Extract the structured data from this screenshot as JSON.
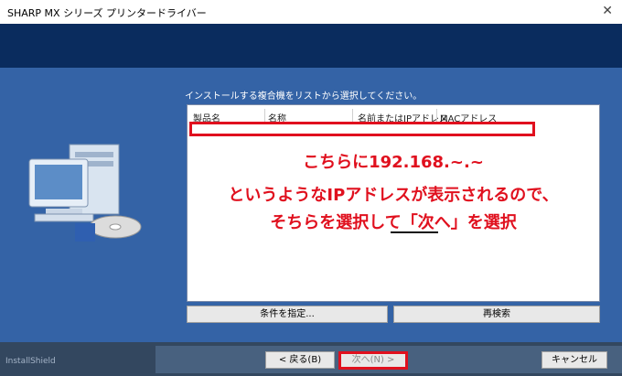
{
  "window": {
    "title": "SHARP MX シリーズ プリンタードライバー"
  },
  "instruction": "インストールする複合機をリストから選択してください。",
  "list": {
    "columns": [
      "製品名",
      "名称",
      "名前またはIPアドレス",
      "MACアドレス"
    ]
  },
  "annotation": {
    "line1": "こちらに192.168.~.~",
    "line2": "というようなIPアドレスが表示されるので、",
    "line3": "そちらを選択して「次へ」を選択"
  },
  "buttons": {
    "conditions": "条件を指定...",
    "research": "再検索",
    "back": "< 戻る(B)",
    "next": "次へ(N) >",
    "cancel": "キャンセル"
  },
  "footer": {
    "brand": "InstallShield"
  },
  "colors": {
    "accent_red": "#e0101e",
    "main_blue": "#3463a6",
    "header_navy": "#0a2c5e"
  }
}
